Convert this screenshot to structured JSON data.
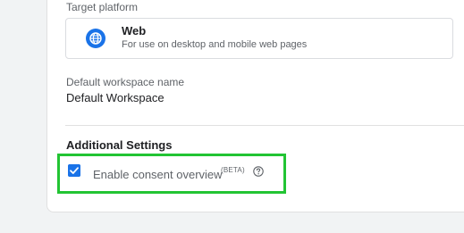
{
  "target_platform": {
    "label": "Target platform",
    "option_title": "Web",
    "option_description": "For use on desktop and mobile web pages",
    "icon": "globe-icon"
  },
  "workspace": {
    "label": "Default workspace name",
    "value": "Default Workspace"
  },
  "additional_settings": {
    "title": "Additional Settings",
    "consent_label": "Enable consent overview",
    "beta_tag": "(BETA)",
    "consent_checked": true,
    "help_icon": "help-circle-icon"
  },
  "colors": {
    "accent": "#1a73e8",
    "highlight_box": "#22c433"
  }
}
